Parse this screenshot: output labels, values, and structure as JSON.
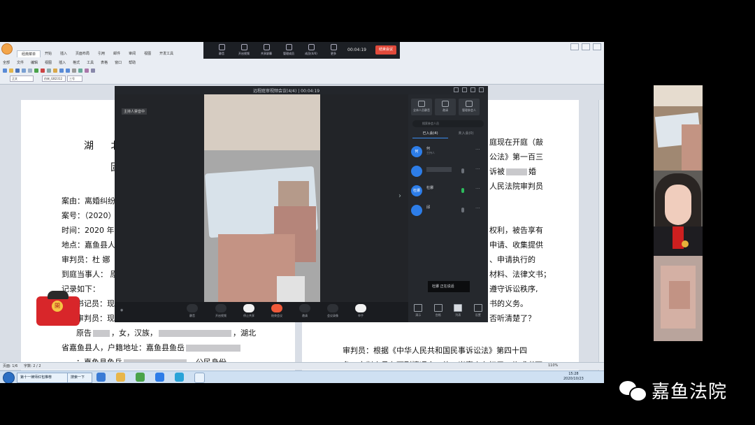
{
  "word": {
    "tabs": [
      "经典菜单",
      "开始",
      "插入",
      "页面布局",
      "引用",
      "邮件",
      "审阅",
      "视图",
      "开发工具"
    ],
    "menus": [
      "全部",
      "文件",
      "编辑",
      "视图",
      "插入",
      "格式",
      "工具",
      "表格",
      "窗口",
      "帮助"
    ],
    "font_style": "正文",
    "font_name": "仿宋_GB2312",
    "font_size": "三号",
    "status_page": "页面: 1/6",
    "status_words": "字数: 2 / 2",
    "zoom": "110%"
  },
  "meeting_bar": {
    "buttons": [
      "静音",
      "开启视频",
      "共享屏幕",
      "管理成员",
      "成员(4/4)",
      "更多"
    ],
    "timer": "00:04:19",
    "end_label": "结束会议"
  },
  "document": {
    "title_line1": "湖 北",
    "title_line2": "固",
    "left_lines": [
      {
        "text": "案由：离婚纠纷",
        "indent": false
      },
      {
        "text": "案号：（2020）",
        "indent": false
      },
      {
        "text": "时间：2020 年",
        "indent": false
      },
      {
        "text": "地点：嘉鱼县人",
        "indent": false
      },
      {
        "text": "审判员：杜 娜",
        "indent": false
      },
      {
        "text": "到庭当事人： 原",
        "indent": false
      },
      {
        "text": "记录如下：",
        "indent": false
      },
      {
        "text": "书记员：现",
        "indent": true
      },
      {
        "text": "审判员：现",
        "indent": true
      }
    ],
    "party_line_a": "原告",
    "party_line_b": "，女，汉族，",
    "party_line_c": "，湖北",
    "party_line2_a": "省嘉鱼县人，户籍地址：嘉鱼县鱼岳",
    "party_line3_a": "：嘉鱼县鱼岳",
    "party_line3_b": "，公民身份",
    "right_lines": [
      "庭现在开庭（敲",
      "公法》第一百三",
      "诉被",
      "婚",
      "人民法院审判员",
      "权利，被告享有",
      "申请、收集提供",
      "、申请执行的",
      "材料、法律文书；",
      "遵守诉讼秩序,",
      "书的义务。",
      "否听清楚了？"
    ],
    "right_bottom_1": "审判员：根据《中华人民共和国民事诉讼法》第四十四",
    "right_bottom_2": "条，审判人员有下列情况之一的，当事人有权用口头或书面"
  },
  "meeting": {
    "title": "远程庭审视频会议(4/4) | 00:04:19",
    "host_tag": "主持人禁音中",
    "side_buttons": [
      "全体人员静音",
      "邀请",
      "管理参会人"
    ],
    "search_placeholder": "搜索参会人员",
    "tab_joined": "已入会(4)",
    "tab_not_joined": "未入会(0)",
    "members": [
      {
        "avatar": "何",
        "name": "何",
        "sub": "主持人"
      },
      {
        "avatar": "",
        "name": "",
        "sub": ""
      },
      {
        "avatar": "杜娜",
        "name": "杜娜",
        "sub": ""
      },
      {
        "avatar": "",
        "name": "邱",
        "sub": ""
      }
    ],
    "speaking": "杜娜  正在说话",
    "controls": [
      "静音",
      "开启视频",
      "停止共享",
      "结束会议",
      "邀请",
      "会议录像",
      "举手"
    ],
    "side_bottom": [
      "演示",
      "宫格",
      "列表",
      "设置"
    ]
  },
  "taskbar": {
    "task1": "第十一律师红包推荐",
    "task2": "搜索一下",
    "time": "15:28",
    "date": "2020/10/23"
  },
  "red_envelope": {
    "coin": "開"
  },
  "watermark": {
    "text": "嘉鱼法院",
    "icon": "wechat-icon"
  }
}
